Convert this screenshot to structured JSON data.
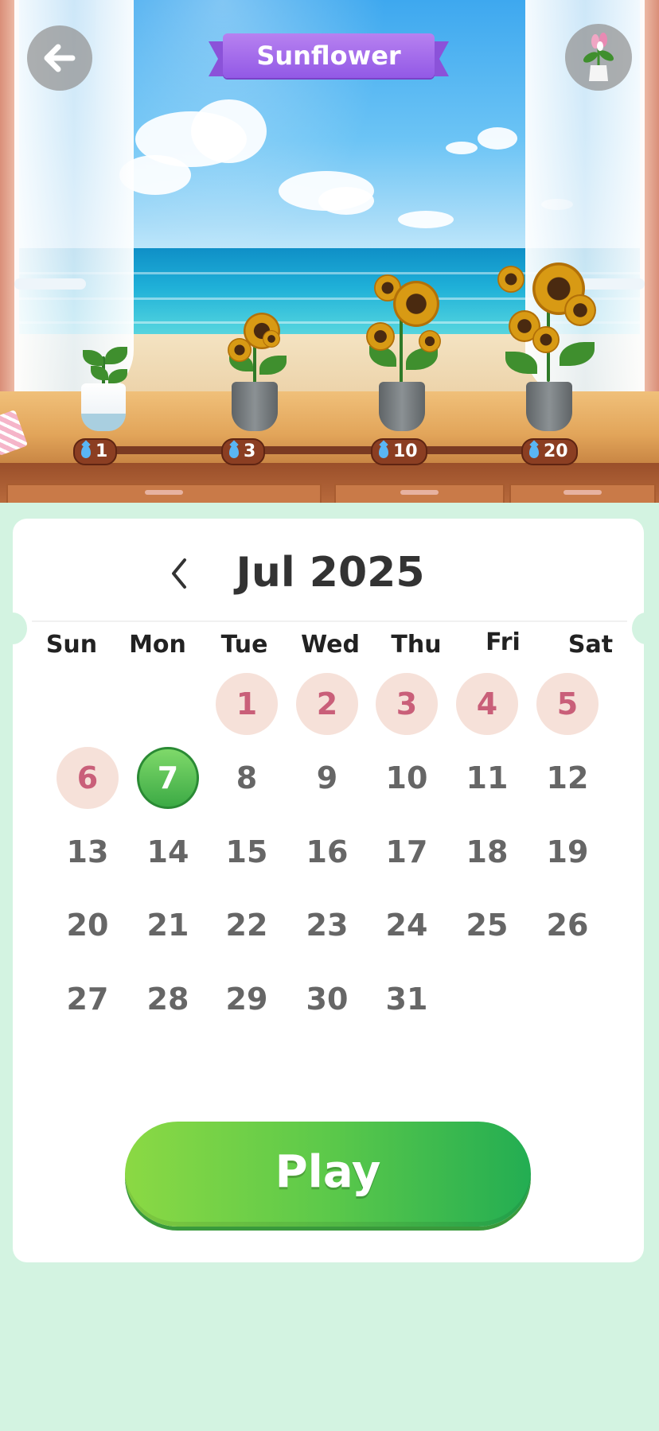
{
  "header": {
    "title": "Sunflower",
    "back_icon": "arrow-left-icon",
    "plant_icon": "potted-plant-icon"
  },
  "milestones": [
    {
      "drops": "1",
      "icon": "water-drop-icon"
    },
    {
      "drops": "3",
      "icon": "water-drop-icon"
    },
    {
      "drops": "10",
      "icon": "water-drop-icon"
    },
    {
      "drops": "20",
      "icon": "water-drop-icon"
    }
  ],
  "calendar": {
    "month_label": "Jul 2025",
    "prev_icon": "chevron-left-icon",
    "weekdays": [
      "Sun",
      "Mon",
      "Tue",
      "Wed",
      "Thu",
      "Fri",
      "Sat"
    ],
    "days": [
      "1",
      "2",
      "3",
      "4",
      "5",
      "6",
      "7",
      "8",
      "9",
      "10",
      "11",
      "12",
      "13",
      "14",
      "15",
      "16",
      "17",
      "18",
      "19",
      "20",
      "21",
      "22",
      "23",
      "24",
      "25",
      "26",
      "27",
      "28",
      "29",
      "30",
      "31"
    ],
    "completed_days": [
      "1",
      "2",
      "3",
      "4",
      "5",
      "6"
    ],
    "today": "7"
  },
  "play_button": {
    "label": "Play"
  },
  "colors": {
    "background": "#d3f3e1",
    "banner": "#9a62e8",
    "completed_day": "#f6e1d9",
    "completed_text": "#c95f79",
    "today": "#3caa45",
    "play": "#5cc94a"
  }
}
